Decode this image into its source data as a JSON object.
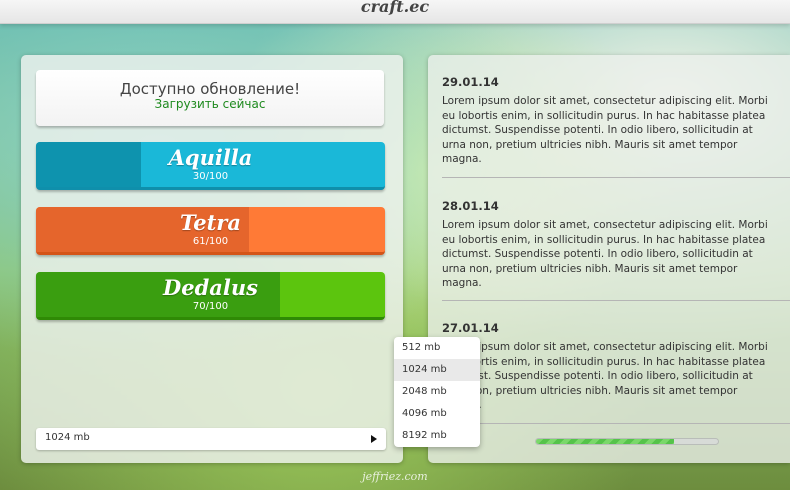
{
  "app": {
    "brand": "craft.ec",
    "watermark": "jeffriez.com"
  },
  "update": {
    "title": "Доступно обновление!",
    "link": "Загрузить сейчас"
  },
  "servers": [
    {
      "name": "Aquilla",
      "count": "30/100",
      "fill": 0.3
    },
    {
      "name": "Tetra",
      "count": "61/100",
      "fill": 0.61
    },
    {
      "name": "Dedalus",
      "count": "70/100",
      "fill": 0.7
    }
  ],
  "memory": {
    "selected": "1024 mb",
    "options": [
      "512 mb",
      "1024 mb",
      "2048 mb",
      "4096 mb",
      "8192 mb"
    ],
    "highlighted": "1024 mb"
  },
  "news": [
    {
      "date": "29.01.14",
      "lines": [
        "Lorem ipsum dolor sit amet, consectetur adipiscing elit. Morbi",
        "eu lobortis enim, in sollicitudin purus. In hac habitasse platea",
        "dictumst. Suspendisse potenti. In odio libero, sollicitudin at",
        "urna non, pretium ultricies nibh. Mauris sit amet tempor",
        "magna."
      ]
    },
    {
      "date": "28.01.14",
      "lines": [
        "Lorem ipsum dolor sit amet, consectetur adipiscing elit. Morbi",
        "eu lobortis enim, in sollicitudin purus. In hac habitasse platea",
        "dictumst. Suspendisse potenti. In odio libero, sollicitudin at",
        "urna non, pretium ultricies nibh. Mauris sit amet tempor",
        "magna."
      ]
    },
    {
      "date": "27.01.14",
      "lines": [
        "Lorem ipsum dolor sit amet, consectetur adipiscing elit. Morbi",
        "eu lobortis enim, in sollicitudin purus. In hac habitasse platea",
        "dictumst. Suspendisse potenti. In odio libero, sollicitudin at",
        "urna non, pretium ultricies nibh. Mauris sit amet tempor",
        "magna."
      ]
    }
  ],
  "download_progress": 0.76
}
